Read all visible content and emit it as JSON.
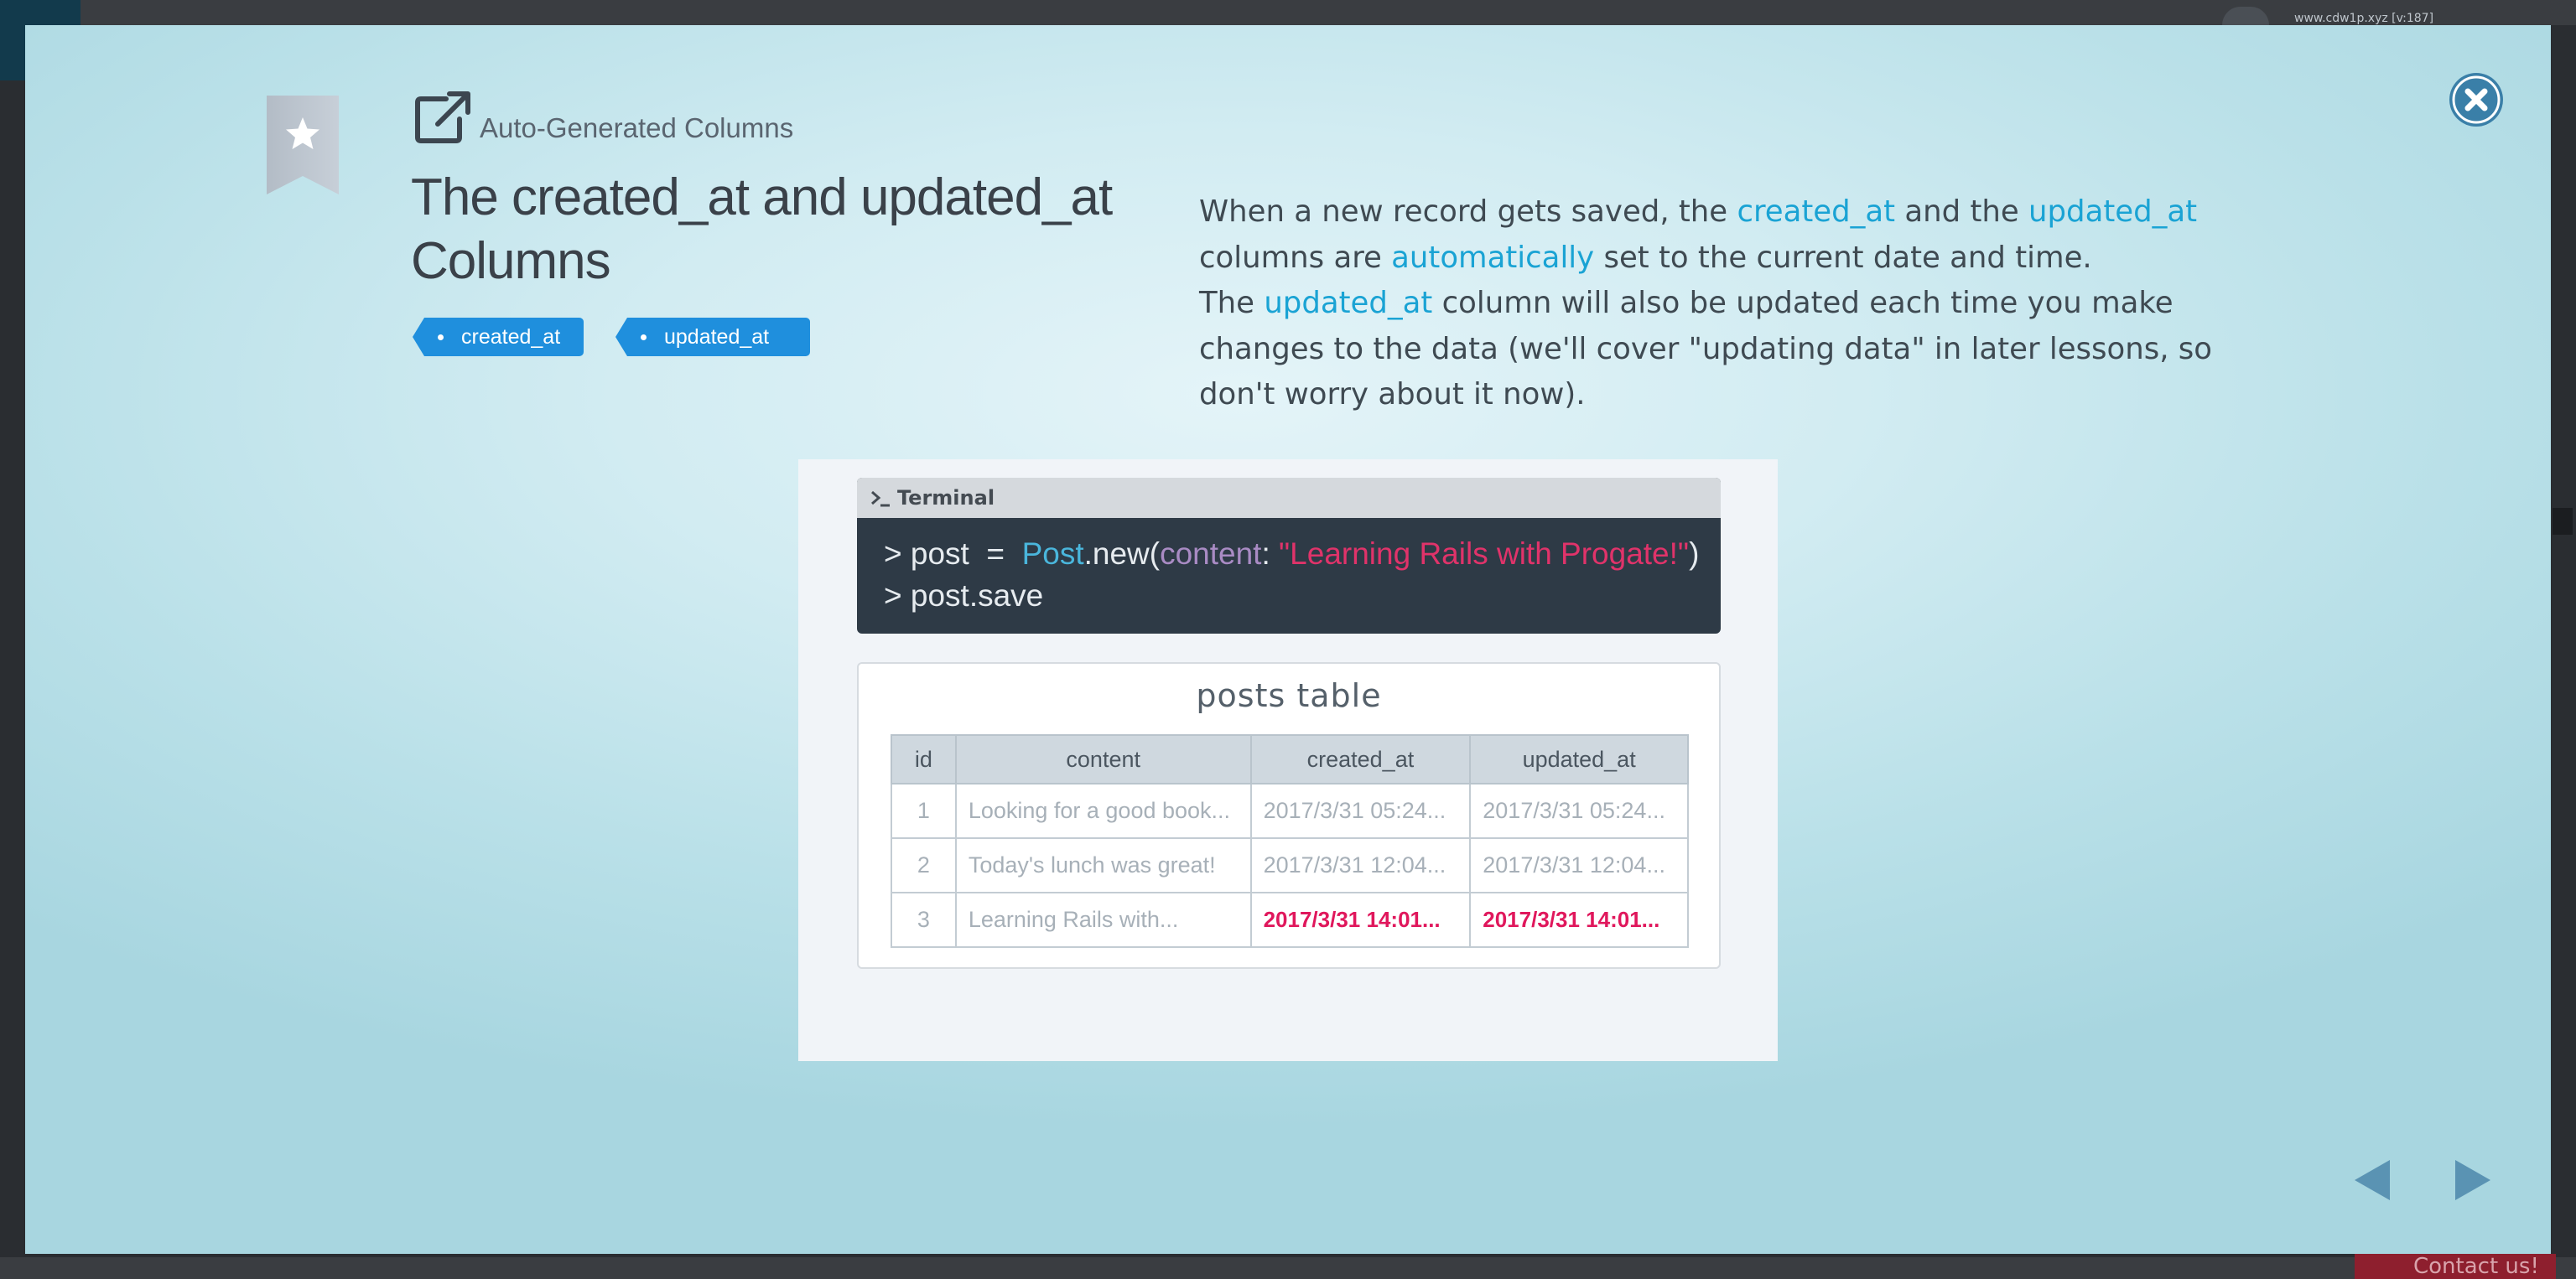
{
  "background": {
    "url_text": "www.cdw1p.xyz [v:187]",
    "contact_label": "Contact us!"
  },
  "slide": {
    "category": "Auto-Generated Columns",
    "title": "The created_at and updated_at Columns",
    "tags": [
      "created_at",
      "updated_at"
    ],
    "description": {
      "p1_a": "When a new record gets saved, the ",
      "p1_b": "created_at",
      "p1_c": " and the ",
      "p1_d": "updated_at",
      "p1_e": " columns are ",
      "p1_f": "automatically",
      "p1_g": " set to the current date and time.",
      "p2_a": "The ",
      "p2_b": "updated_at",
      "p2_c": " column will also be updated each time you make changes to the data (we'll cover \"updating data\" in later lessons, so don't worry about it now)."
    }
  },
  "terminal": {
    "title": "Terminal",
    "line1_prompt": "> post  =  ",
    "line1_class": "Post",
    "line1_method": ".new(",
    "line1_key": "content",
    "line1_colon": ": ",
    "line1_string": "\"Learning Rails with Progate!\"",
    "line1_close": ")",
    "line2": "> post.save"
  },
  "posts_table": {
    "title": "posts table",
    "columns": [
      "id",
      "content",
      "created_at",
      "updated_at"
    ],
    "rows": [
      {
        "id": "1",
        "content": "Looking for a good book...",
        "created_at": "2017/3/31 05:24...",
        "updated_at": "2017/3/31 05:24..."
      },
      {
        "id": "2",
        "content": "Today's lunch was great!",
        "created_at": "2017/3/31 12:04...",
        "updated_at": "2017/3/31 12:04..."
      },
      {
        "id": "3",
        "content": "Learning Rails with...",
        "created_at": "2017/3/31 14:01...",
        "updated_at": "2017/3/31 14:01..."
      }
    ]
  },
  "colors": {
    "accent_blue": "#1f8fdd",
    "highlight_text": "#1aa3d4",
    "new_record_red": "#e0175c",
    "close_button": "#3a7fa8"
  },
  "icons": [
    "bookmark-star-icon",
    "external-link-icon",
    "close-icon",
    "terminal-prompt-icon",
    "arrow-left-icon",
    "arrow-right-icon"
  ]
}
